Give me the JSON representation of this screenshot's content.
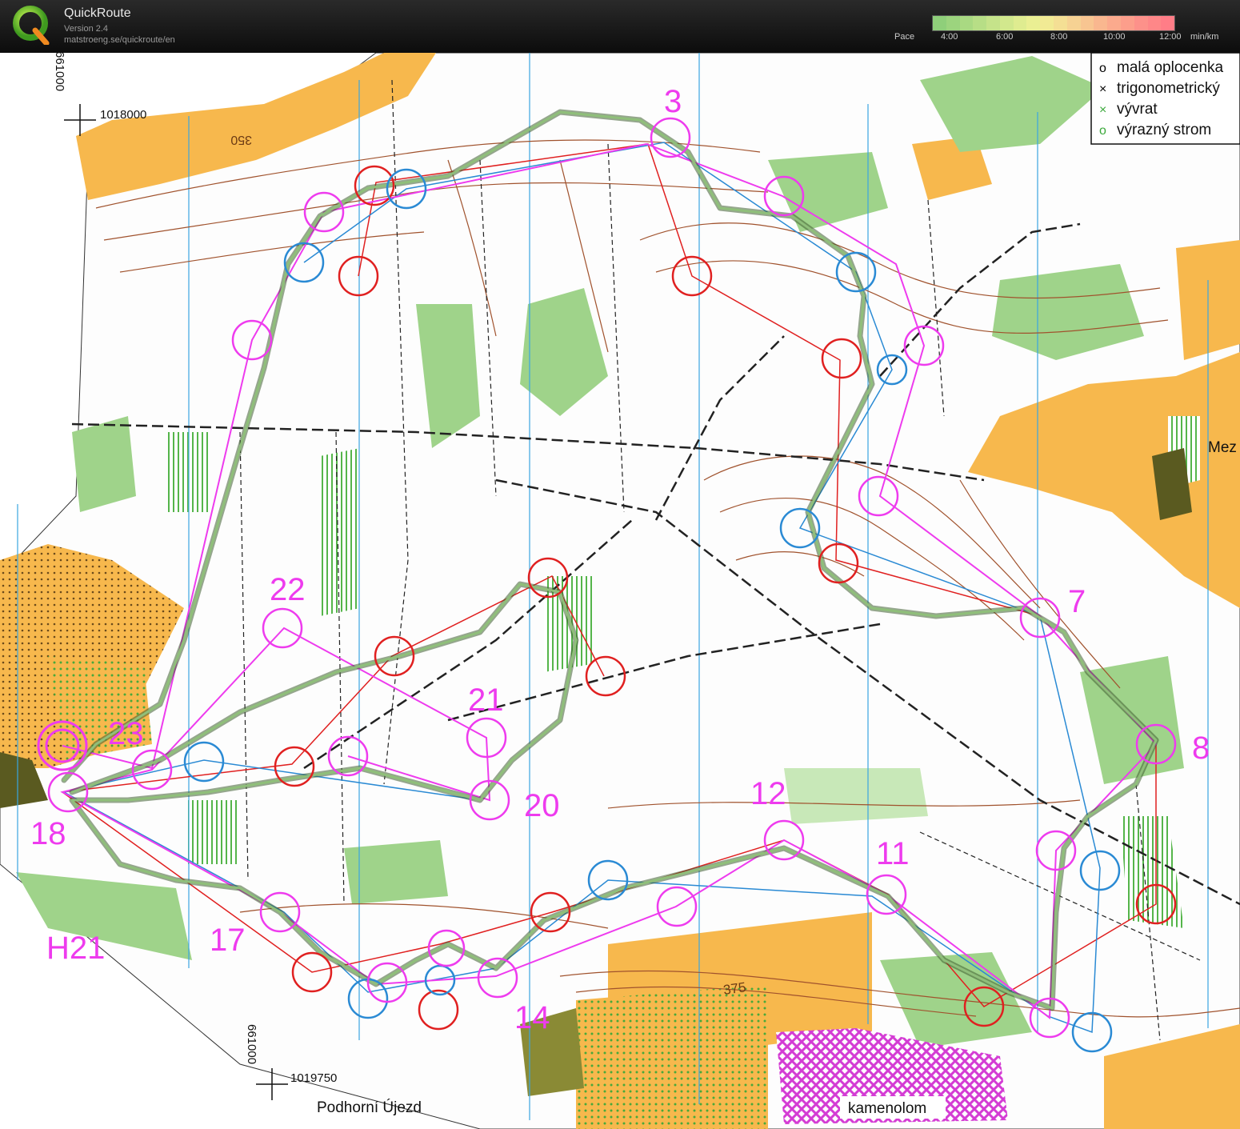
{
  "app": {
    "name": "QuickRoute",
    "version": "Version 2.4",
    "url": "matstroeng.se/quickroute/en"
  },
  "pace": {
    "label": "Pace",
    "ticks": [
      "4:00",
      "6:00",
      "8:00",
      "10:00",
      "12:00"
    ],
    "unit": "min/km",
    "colors": [
      "#8fcf7a",
      "#9cd47e",
      "#a9d982",
      "#b7de86",
      "#c5e38a",
      "#d2e88d",
      "#dfec90",
      "#eaef93",
      "#f1ea94",
      "#f4df94",
      "#f6d293",
      "#f8c591",
      "#f9b78f",
      "#fbaa8d",
      "#fc9e8b",
      "#fd918a",
      "#fe8788",
      "#ff7d87"
    ]
  },
  "legend": {
    "items": [
      {
        "symbol": "o",
        "text": "malá oplocenka",
        "color": "#000000"
      },
      {
        "symbol": "×",
        "text": "trigonometrický",
        "color": "#000000"
      },
      {
        "symbol": "×",
        "text": "vývrat",
        "color": "#3aa83a"
      },
      {
        "symbol": "o",
        "text": "výrazný strom",
        "color": "#3aa83a"
      }
    ]
  },
  "map_labels": {
    "class_name": "H21",
    "town": "Podhorní Újezd",
    "quarry": "kamenolom",
    "village_partial": "Mez",
    "contour_375": "375",
    "contour_350": "350",
    "coord_top_vertical": "661000",
    "coord_top_horizontal": "1018000",
    "coord_bottom_vertical": "661000",
    "coord_bottom_horizontal": "1019750"
  },
  "controls": [
    {
      "number": "3"
    },
    {
      "number": "7"
    },
    {
      "number": "8"
    },
    {
      "number": "11"
    },
    {
      "number": "12"
    },
    {
      "number": "14"
    },
    {
      "number": "17"
    },
    {
      "number": "18"
    },
    {
      "number": "20"
    },
    {
      "number": "21"
    },
    {
      "number": "22"
    },
    {
      "number": "23"
    }
  ],
  "colors": {
    "course": "#ee3bee",
    "route": "#6e9a55",
    "red_route": "#e02020",
    "blue_route": "#2a8ad4",
    "forest": "#9fd38a",
    "open": "#f7b84d"
  }
}
